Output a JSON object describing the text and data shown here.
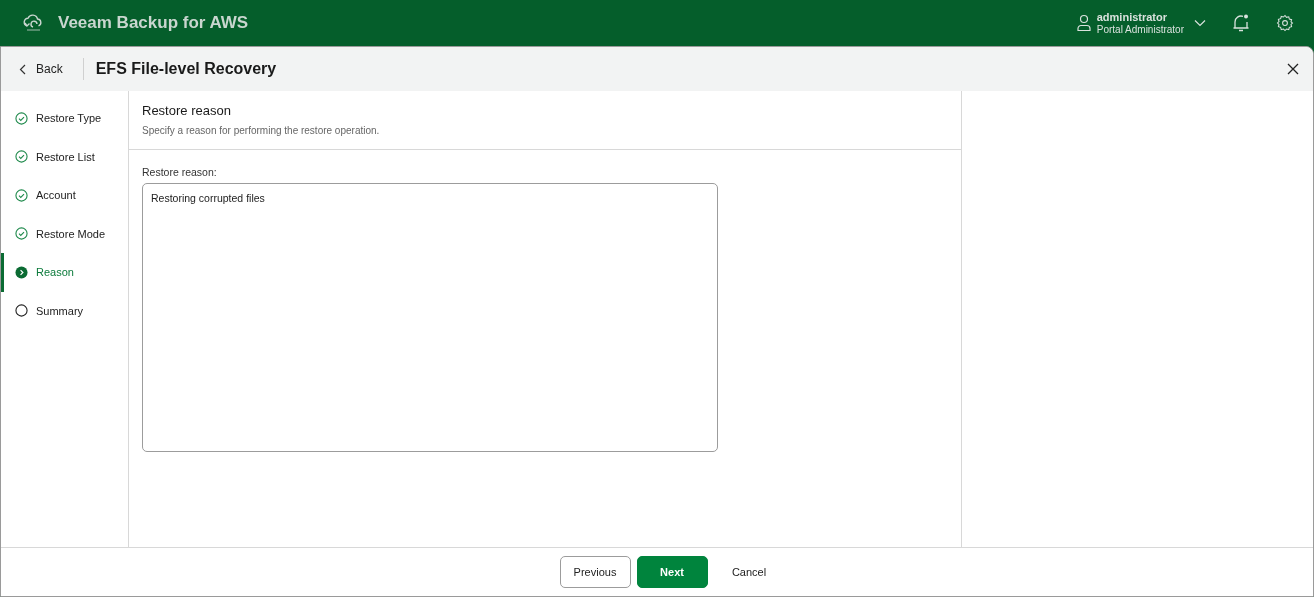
{
  "app_bar": {
    "title": "Veeam Backup for AWS",
    "user": {
      "name": "administrator",
      "role": "Portal Administrator"
    },
    "notification_dot": true
  },
  "header": {
    "back": "Back",
    "title": "EFS File-level Recovery"
  },
  "steps": [
    {
      "label": "Restore Type",
      "kind": "done",
      "selected": false
    },
    {
      "label": "Restore List",
      "kind": "done",
      "selected": false
    },
    {
      "label": "Account",
      "kind": "done",
      "selected": false
    },
    {
      "label": "Restore Mode",
      "kind": "done",
      "selected": false
    },
    {
      "label": "Reason",
      "kind": "current",
      "selected": true
    },
    {
      "label": "Summary",
      "kind": "pending",
      "selected": false
    }
  ],
  "section": {
    "title": "Restore reason",
    "description": "Specify a reason for performing the restore operation."
  },
  "reason_field": {
    "label": "Restore reason:",
    "value": "Restoring corrupted files"
  },
  "buttons": [
    {
      "label": "Previous",
      "kind": "secondary"
    },
    {
      "label": "Next",
      "kind": "primary"
    },
    {
      "label": "Cancel",
      "kind": "link"
    }
  ]
}
